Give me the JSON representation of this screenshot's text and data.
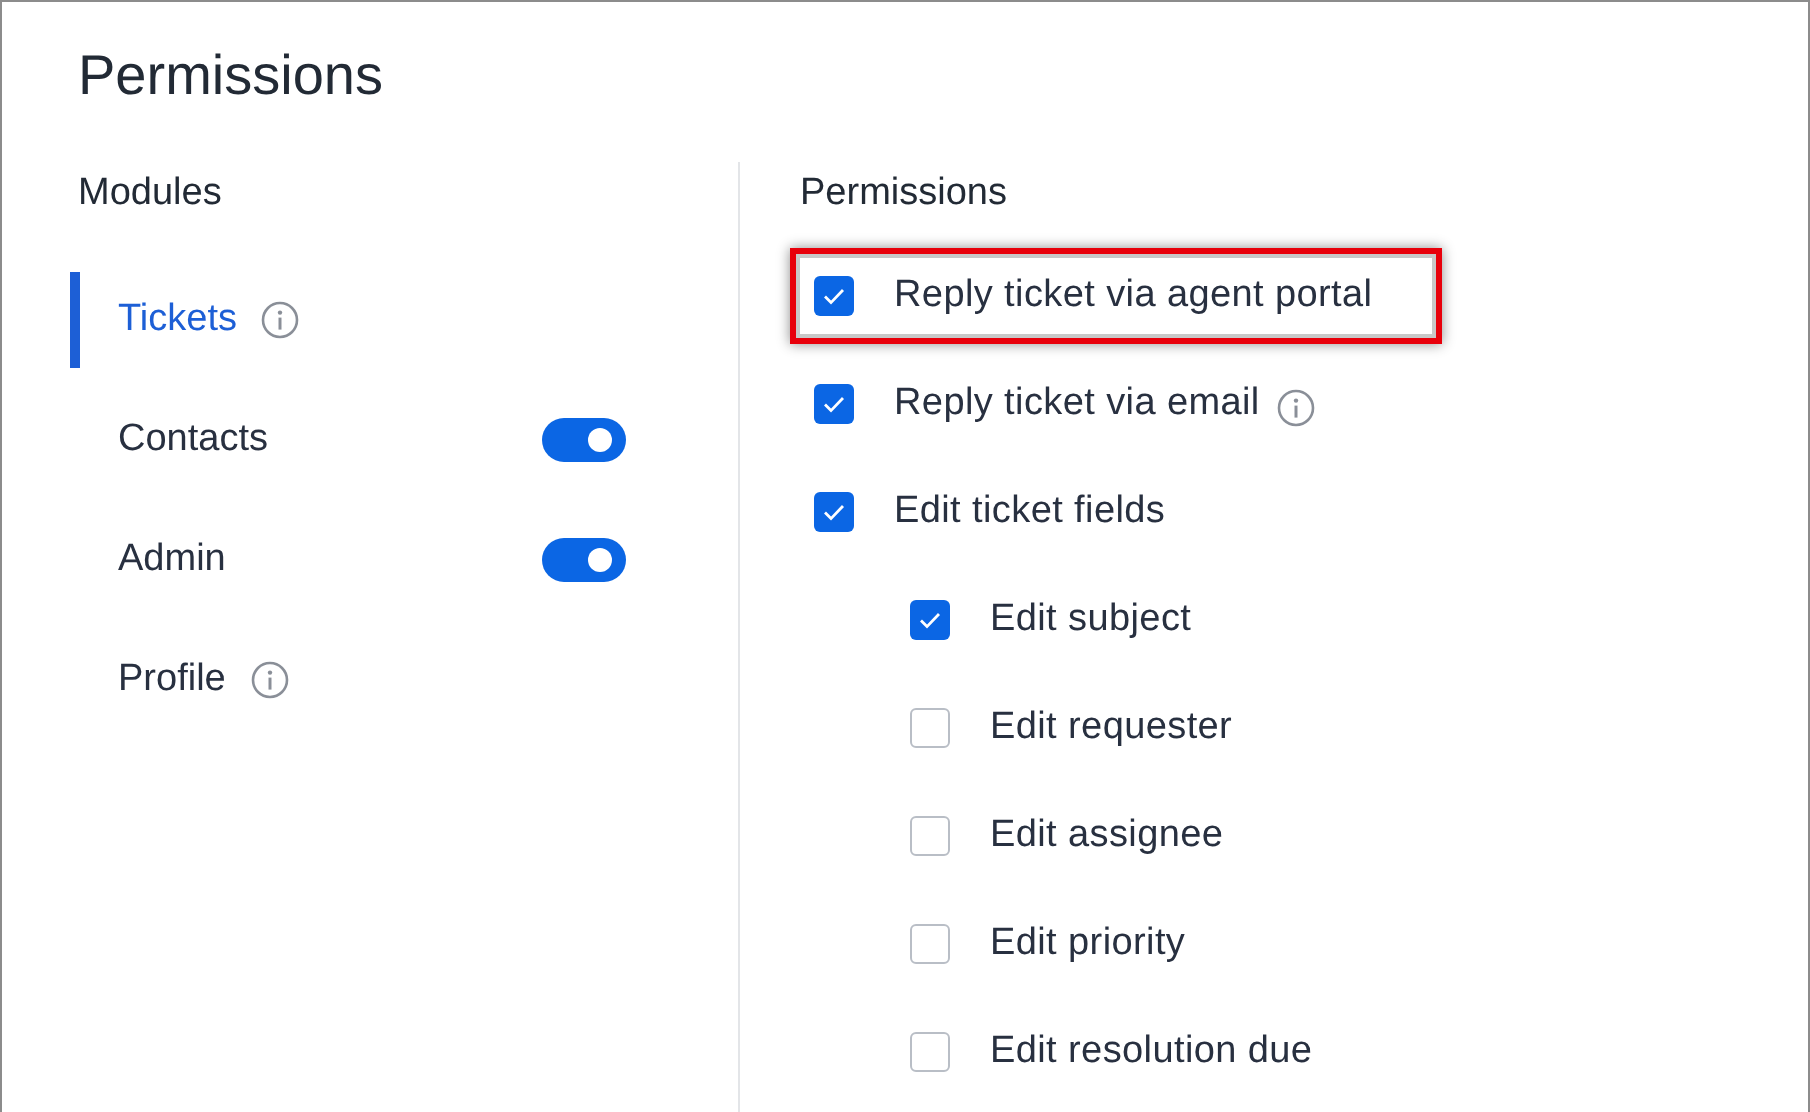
{
  "title": "Permissions",
  "modules": {
    "heading": "Modules",
    "items": [
      {
        "label": "Tickets",
        "selected": true,
        "kind": "info"
      },
      {
        "label": "Contacts",
        "selected": false,
        "kind": "toggle",
        "on": true
      },
      {
        "label": "Admin",
        "selected": false,
        "kind": "toggle",
        "on": true
      },
      {
        "label": "Profile",
        "selected": false,
        "kind": "info"
      }
    ]
  },
  "permissions": {
    "heading": "Permissions",
    "items": [
      {
        "label": "Reply ticket via agent portal",
        "checked": true,
        "highlighted": true
      },
      {
        "label": "Reply ticket via email",
        "checked": true,
        "info": true,
        "highlighted": false
      },
      {
        "label": "Edit ticket fields",
        "checked": true,
        "highlighted": false,
        "children": [
          {
            "label": "Edit subject",
            "checked": true
          },
          {
            "label": "Edit requester",
            "checked": false
          },
          {
            "label": "Edit assignee",
            "checked": false
          },
          {
            "label": "Edit priority",
            "checked": false
          },
          {
            "label": "Edit resolution due",
            "checked": false
          }
        ]
      }
    ]
  }
}
